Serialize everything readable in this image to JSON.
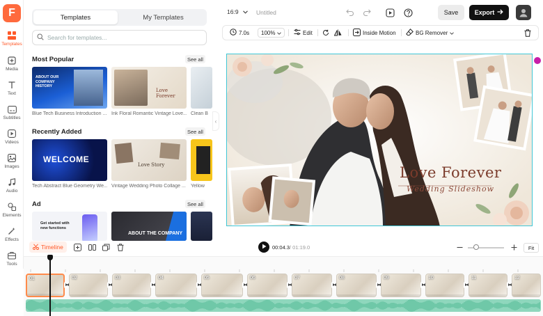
{
  "app": {
    "logo_letter": "F"
  },
  "rail": {
    "items": [
      {
        "label": "Templates",
        "icon": "templates-icon",
        "active": true
      },
      {
        "label": "Media",
        "icon": "media-icon"
      },
      {
        "label": "Text",
        "icon": "text-icon"
      },
      {
        "label": "Subtitles",
        "icon": "subtitles-icon"
      },
      {
        "label": "Videos",
        "icon": "videos-icon"
      },
      {
        "label": "Images",
        "icon": "images-icon"
      },
      {
        "label": "Audio",
        "icon": "audio-icon"
      },
      {
        "label": "Elements",
        "icon": "elements-icon"
      },
      {
        "label": "Effects",
        "icon": "effects-icon"
      },
      {
        "label": "Tools",
        "icon": "tools-icon"
      }
    ]
  },
  "panel": {
    "tabs": [
      {
        "label": "Templates",
        "active": true
      },
      {
        "label": "My Templates"
      }
    ],
    "search_placeholder": "Search for templates...",
    "sections": [
      {
        "title": "Most Popular",
        "see_all": "See all",
        "cards": [
          {
            "label": "Blue Tech Business Introduction ...",
            "overlay": "ABOUT OUR COMPANY HISTORY"
          },
          {
            "label": "Ink Floral Romantic Vintage Love...",
            "overlay": "Love Forever"
          },
          {
            "label": "Clean B",
            "overlay": ""
          }
        ]
      },
      {
        "title": "Recently Added",
        "see_all": "See all",
        "cards": [
          {
            "label": "Tech Abstract Blue Geometry We...",
            "overlay": "WELCOME"
          },
          {
            "label": "Vintage Wedding Photo Collage ...",
            "overlay": "Love Story"
          },
          {
            "label": "Yellow",
            "overlay": ""
          }
        ]
      },
      {
        "title": "Ad",
        "see_all": "See all",
        "cards": [
          {
            "label": "",
            "overlay": "Get started with new functions"
          },
          {
            "label": "",
            "overlay": "ABOUT THE COMPANY"
          },
          {
            "label": "",
            "overlay": ""
          }
        ]
      }
    ]
  },
  "topbar": {
    "aspect_ratio": "16:9",
    "document_title": "Untitled",
    "save_label": "Save",
    "export_label": "Export"
  },
  "toolbar": {
    "duration": "7.0s",
    "zoom": "100%",
    "edit_label": "Edit",
    "inside_motion_label": "Inside Motion",
    "bg_remover_label": "BG Remover"
  },
  "canvas": {
    "headline": "Love Forever",
    "subline": "Wedding Slideshow"
  },
  "playback": {
    "timeline_label": "Timeline",
    "current_time": "00:04.3",
    "total_time": "/ 01:19.0",
    "fit_label": "Fit",
    "zoom_level": 0.2
  },
  "timeline": {
    "clips": [
      "01",
      "02",
      "03",
      "04",
      "05",
      "06",
      "07",
      "08",
      "09",
      "10",
      "11",
      "12"
    ]
  },
  "colors": {
    "accent": "#ff5a2a",
    "selection": "#3ec6d6",
    "audio": "#8fd7bd"
  }
}
